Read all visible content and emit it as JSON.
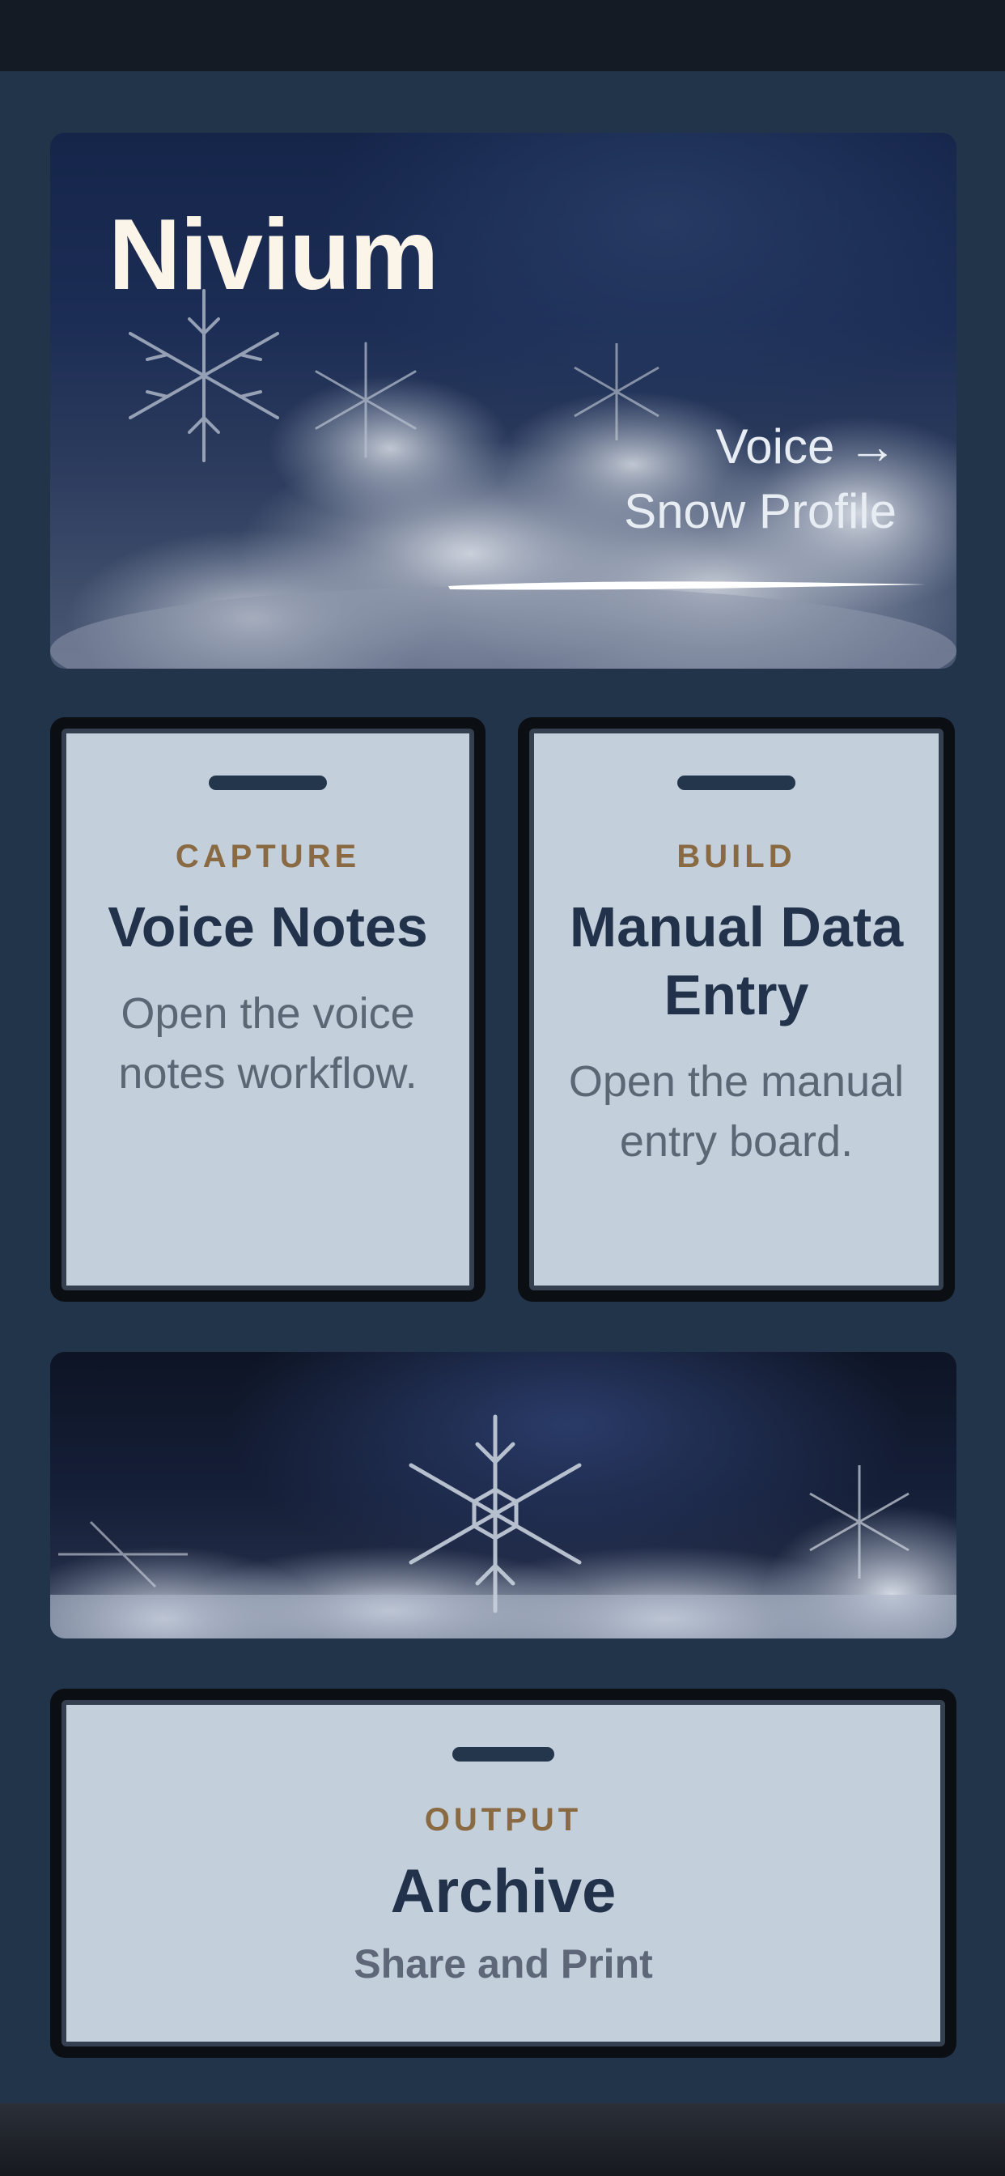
{
  "app": {
    "brand": "Nivium"
  },
  "hero": {
    "link_line1": "Voice →",
    "link_line2": "Snow Profile"
  },
  "cards": [
    {
      "eyebrow": "CAPTURE",
      "title": "Voice Notes",
      "description": "Open the voice notes workflow."
    },
    {
      "eyebrow": "BUILD",
      "title": "Manual Data Entry",
      "description": "Open the manual entry board."
    },
    {
      "eyebrow": "OUTPUT",
      "title": "Archive",
      "subtitle": "Share and Print"
    }
  ],
  "colors": {
    "background": "#223449",
    "card": "#c3cfdb",
    "accent": "#8a6a43",
    "title": "#22324a",
    "brand": "#fbf4e8"
  },
  "icons": {
    "card_handle": "drag-handle-icon",
    "hero_image": "snowflake-image",
    "banner_image": "snow-crystals-image"
  }
}
